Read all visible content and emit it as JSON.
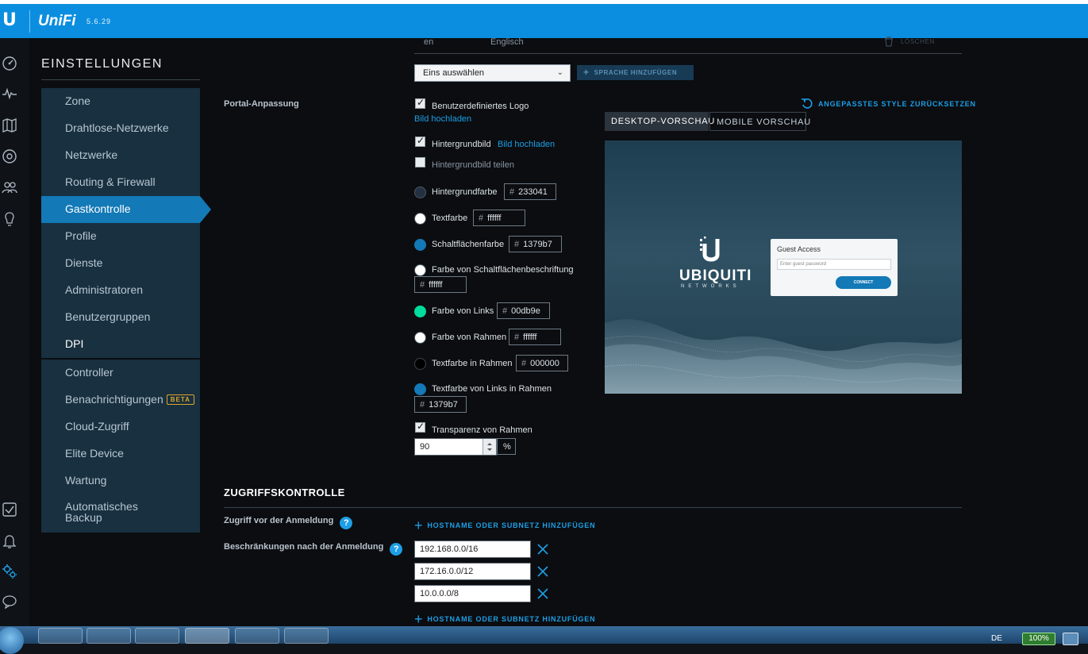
{
  "app": {
    "brand": "UniFi",
    "version": "5.6.29",
    "logo": "ubiquiti-u-logo"
  },
  "sidebar": {
    "title": "EINSTELLUNGEN",
    "items": [
      {
        "label": "Zone"
      },
      {
        "label": "Drahtlose-Netzwerke"
      },
      {
        "label": "Netzwerke"
      },
      {
        "label": "Routing & Firewall"
      },
      {
        "label": "Gastkontrolle",
        "active": true
      },
      {
        "label": "Profile"
      },
      {
        "label": "Dienste"
      },
      {
        "label": "Administratoren"
      },
      {
        "label": "Benutzergruppen"
      },
      {
        "label": "DPI"
      },
      {
        "label": "Controller"
      },
      {
        "label": "Benachrichtigungen",
        "badge": "BETA"
      },
      {
        "label": "Cloud-Zugriff"
      },
      {
        "label": "Elite Device"
      },
      {
        "label": "Wartung"
      },
      {
        "label_line1": "Automatisches",
        "label_line2": "Backup"
      }
    ]
  },
  "rail_icons": [
    "dashboard-icon",
    "statistics-icon",
    "map-icon",
    "devices-icon",
    "clients-icon",
    "insights-icon",
    "alerts-check-icon",
    "bell-icon",
    "settings-gears-icon",
    "chat-icon"
  ],
  "language": {
    "code": "en",
    "name": "Englisch",
    "delete_label": "LÖSCHEN",
    "select_placeholder": "Eins auswählen",
    "add_button": "SPRACHE HINZUFÜGEN"
  },
  "portal": {
    "label": "Portal-Anpassung",
    "custom_logo": {
      "label": "Benutzerdefiniertes Logo",
      "checked": true,
      "upload": "Bild hochladen"
    },
    "background_image": {
      "label": "Hintergrundbild",
      "checked": true,
      "upload": "Bild hochladen"
    },
    "tile_background": {
      "label": "Hintergrundbild teilen",
      "checked": false
    },
    "colors": {
      "background": {
        "label": "Hintergrundfarbe",
        "value": "233041",
        "color": "#233041"
      },
      "text": {
        "label": "Textfarbe",
        "value": "ffffff",
        "color": "#ffffff"
      },
      "button": {
        "label": "Schaltflächenfarbe",
        "value": "1379b7",
        "color": "#1379b7"
      },
      "button_text": {
        "label": "Farbe von Schaltflächenbeschriftung",
        "value": "ffffff",
        "color": "#ffffff"
      },
      "links": {
        "label": "Farbe von Links",
        "value": "00db9e",
        "color": "#00db9e"
      },
      "box": {
        "label": "Farbe von Rahmen",
        "value": "ffffff",
        "color": "#ffffff"
      },
      "box_text": {
        "label": "Textfarbe in Rahmen",
        "value": "000000",
        "color": "#000000"
      },
      "box_links": {
        "label": "Textfarbe von Links in Rahmen",
        "value": "1379b7",
        "color": "#1379b7"
      }
    },
    "hash": "#",
    "transparency": {
      "label": "Transparenz von Rahmen",
      "checked": true,
      "value": "90",
      "unit": "%"
    },
    "reset_label": "ANGEPASSTES STYLE ZURÜCKSETZEN",
    "tabs": [
      {
        "label": "DESKTOP-VORSCHAU",
        "active": true
      },
      {
        "label": "MOBILE VORSCHAU",
        "active": false
      }
    ],
    "preview": {
      "brand_line1": "UBIQUITI",
      "brand_line2": "NETWORKS",
      "card_title": "Guest Access",
      "card_placeholder": "Enter guest password",
      "card_button": "CONNECT"
    }
  },
  "access": {
    "title": "ZUGRIFFSKONTROLLE",
    "pre_auth_label": "Zugriff vor der Anmeldung",
    "post_auth_label": "Beschränkungen nach der Anmeldung",
    "add_label": "HOSTNAME ODER SUBNETZ HINZUFÜGEN",
    "help": "?",
    "restrictions": [
      "192.168.0.0/16",
      "172.16.0.0/12",
      "10.0.0.0/8"
    ]
  },
  "taskbar": {
    "lang": "DE",
    "battery": "100%"
  },
  "colors": {
    "accent": "#1379b7",
    "topbar": "#0b8ee0",
    "link": "#1d9ee6"
  }
}
